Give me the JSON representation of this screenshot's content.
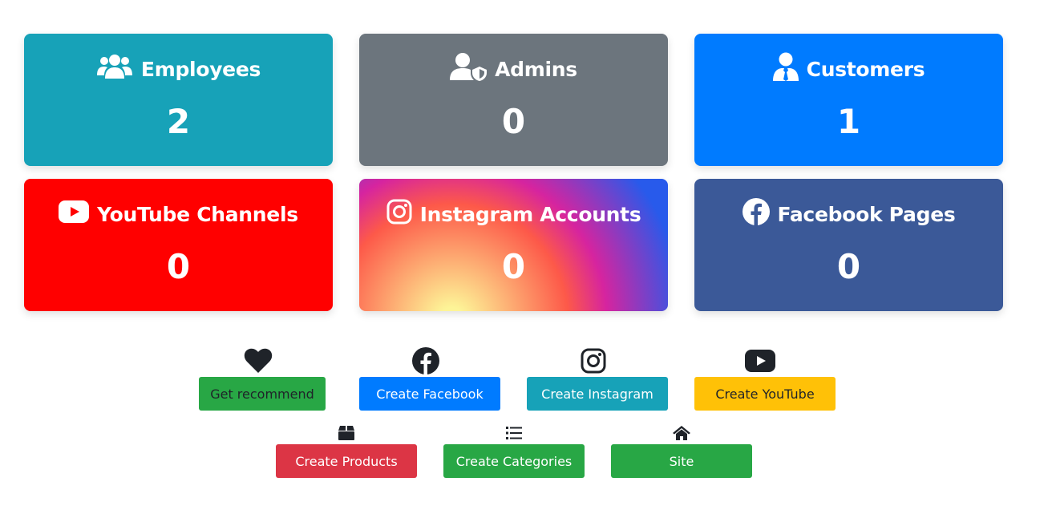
{
  "cards": [
    {
      "title": "Employees",
      "value": "2",
      "icon": "users-icon",
      "color": "#17a2b8"
    },
    {
      "title": "Admins",
      "value": "0",
      "icon": "user-shield-icon",
      "color": "#6c757d"
    },
    {
      "title": "Customers",
      "value": "1",
      "icon": "user-tie-icon",
      "color": "#007bff"
    },
    {
      "title": "YouTube Channels",
      "value": "0",
      "icon": "youtube-icon",
      "color": "#ff0000"
    },
    {
      "title": "Instagram Accounts",
      "value": "0",
      "icon": "instagram-icon",
      "color": "gradient"
    },
    {
      "title": "Facebook Pages",
      "value": "0",
      "icon": "facebook-icon",
      "color": "#3b5998"
    }
  ],
  "actions": [
    {
      "label": "Get recommend",
      "icon": "heart-icon",
      "color": "#28a745",
      "text_color": "#1f2329"
    },
    {
      "label": "Create Facebook",
      "icon": "facebook-icon",
      "color": "#007bff",
      "text_color": "#ffffff"
    },
    {
      "label": "Create Instagram",
      "icon": "instagram-icon",
      "color": "#17a2b8",
      "text_color": "#ffffff"
    },
    {
      "label": "Create YouTube",
      "icon": "youtube-icon",
      "color": "#ffc107",
      "text_color": "#1f2329"
    },
    {
      "label": "Create Products",
      "icon": "box-icon",
      "color": "#dc3545",
      "text_color": "#ffffff"
    },
    {
      "label": "Create Categories",
      "icon": "list-icon",
      "color": "#28a745",
      "text_color": "#ffffff"
    },
    {
      "label": "Site",
      "icon": "home-icon",
      "color": "#28a745",
      "text_color": "#ffffff"
    }
  ]
}
